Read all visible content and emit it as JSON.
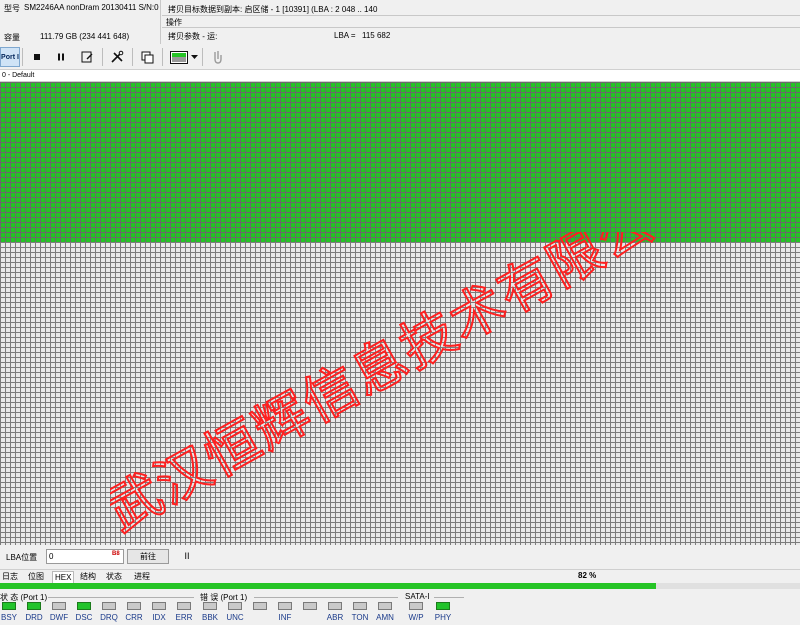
{
  "info": {
    "model_label": "型号",
    "model_value": "SM2246AA nonDram 20130411 S/N:0",
    "capacity_label": "容量",
    "capacity_value": "111.79 GB (234 441 648)",
    "task_title": "拷贝目标数据到副本: 启区储 - 1 [10391] (LBA : 2 048 .. 140",
    "operation_label": "操作",
    "copy_params_label": "拷贝参数 - 运:",
    "lba_label": "LBA =",
    "lba_value": "115 682"
  },
  "toolbar": {
    "port_label": "Port I"
  },
  "map": {
    "header": "0 - Default",
    "done_color": "#25c425",
    "pending_color": "#e9e9e9"
  },
  "watermark": "武汉恒辉信息技术有限公司",
  "lba_bar": {
    "label": "LBA位置",
    "value": "0",
    "badge": "B8",
    "goto_label": "前往",
    "pause_label": "II"
  },
  "tabs": [
    "日志",
    "位图",
    "HEX",
    "结构",
    "状态",
    "进程"
  ],
  "active_tab": "HEX",
  "progress": {
    "percent_text": "82 %",
    "fraction": 0.82
  },
  "status": {
    "state_group": "状 态 (Port 1)",
    "error_group": "错 误 (Port 1)",
    "sata_group": "SATA-I",
    "state_indicators": [
      {
        "label": "BSY",
        "on": true
      },
      {
        "label": "DRD",
        "on": true
      },
      {
        "label": "DWF",
        "on": false
      },
      {
        "label": "DSC",
        "on": true
      },
      {
        "label": "DRQ",
        "on": false
      },
      {
        "label": "CRR",
        "on": false
      },
      {
        "label": "IDX",
        "on": false
      },
      {
        "label": "ERR",
        "on": false
      }
    ],
    "error_indicators": [
      {
        "label": "BBK",
        "on": false
      },
      {
        "label": "UNC",
        "on": false
      },
      {
        "label": "",
        "on": false
      },
      {
        "label": "INF",
        "on": false
      },
      {
        "label": "",
        "on": false
      },
      {
        "label": "ABR",
        "on": false
      },
      {
        "label": "TON",
        "on": false
      },
      {
        "label": "AMN",
        "on": false
      }
    ],
    "sata_indicators": [
      {
        "label": "W/P",
        "on": false
      },
      {
        "label": "PHY",
        "on": true
      }
    ]
  }
}
